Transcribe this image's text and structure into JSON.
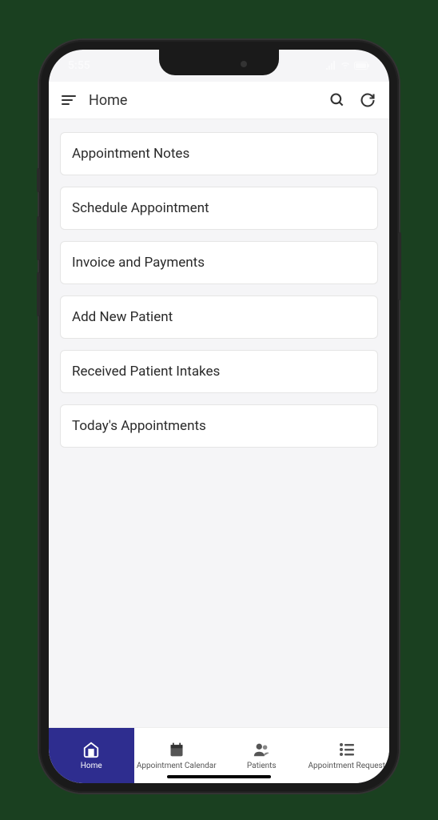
{
  "status": {
    "time": "5:55"
  },
  "header": {
    "title": "Home"
  },
  "menuItems": [
    {
      "label": "Appointment Notes"
    },
    {
      "label": "Schedule Appointment"
    },
    {
      "label": "Invoice and Payments"
    },
    {
      "label": "Add New Patient"
    },
    {
      "label": "Received Patient Intakes"
    },
    {
      "label": "Today's Appointments"
    }
  ],
  "bottomNav": [
    {
      "label": "Home",
      "icon": "home-icon",
      "active": true
    },
    {
      "label": "Appointment Calendar",
      "icon": "calendar-icon",
      "active": false
    },
    {
      "label": "Patients",
      "icon": "patients-icon",
      "active": false
    },
    {
      "label": "Appointment Request",
      "icon": "list-icon",
      "active": false
    }
  ]
}
